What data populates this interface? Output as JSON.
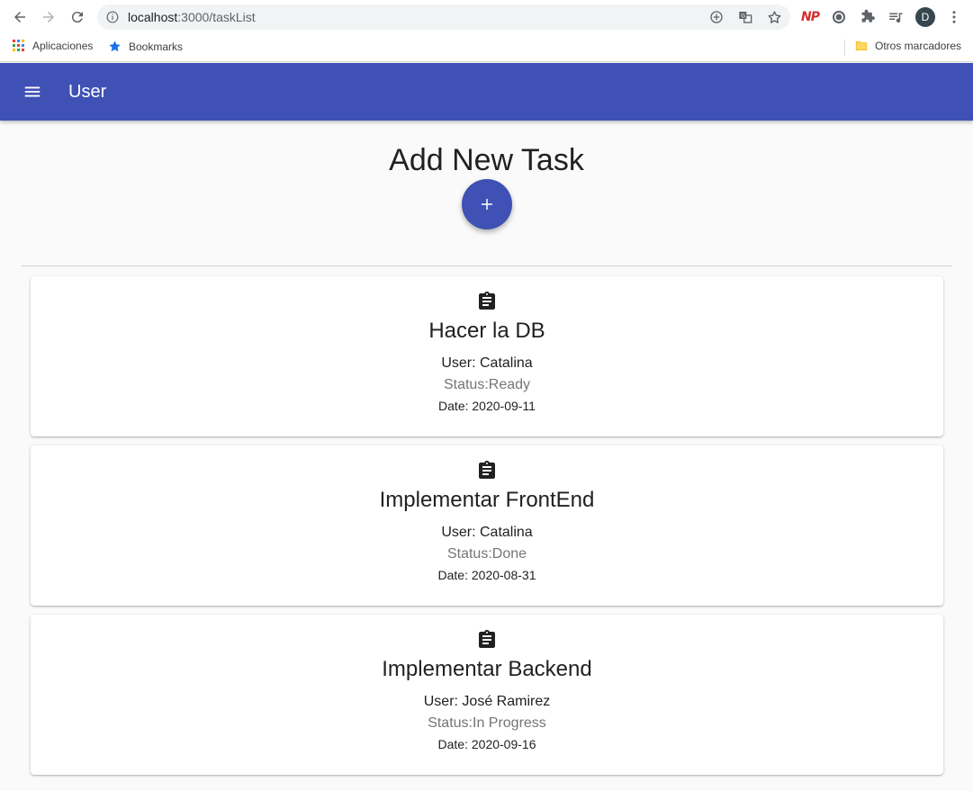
{
  "browser": {
    "url_host": "localhost",
    "url_path": ":3000/taskList",
    "bookmarks": [
      {
        "label": "Aplicaciones",
        "icon": "apps-grid-icon"
      },
      {
        "label": "Bookmarks",
        "icon": "star-icon"
      }
    ],
    "other_bookmarks": "Otros marcadores",
    "extension_np": "NP",
    "profile_initial": "D"
  },
  "app_bar": {
    "title": "User",
    "color": "#3f51b5"
  },
  "main": {
    "heading": "Add New Task",
    "add_button_icon": "plus-icon"
  },
  "tasks": [
    {
      "title": "Hacer la DB",
      "user": "User: Catalina",
      "status": "Status:Ready",
      "date": "Date: 2020-09-11"
    },
    {
      "title": "Implementar FrontEnd",
      "user": "User: Catalina",
      "status": "Status:Done",
      "date": "Date: 2020-08-31"
    },
    {
      "title": "Implementar Backend",
      "user": "User: José Ramirez",
      "status": "Status:In Progress",
      "date": "Date: 2020-09-16"
    }
  ]
}
